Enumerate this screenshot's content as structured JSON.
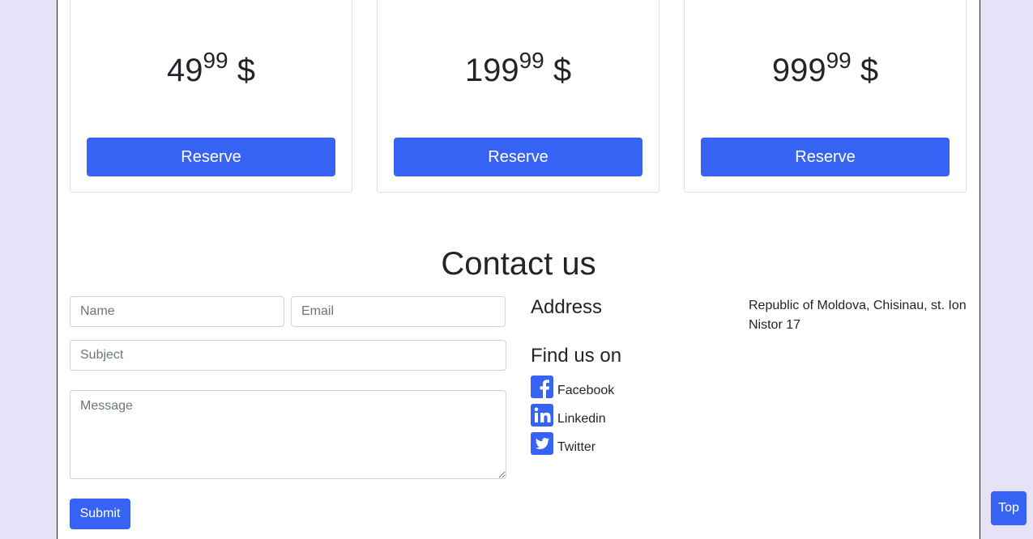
{
  "pricing": {
    "plans": [
      {
        "price_main": "49",
        "price_cents": "99",
        "currency": "$",
        "button_label": "Reserve"
      },
      {
        "price_main": "199",
        "price_cents": "99",
        "currency": "$",
        "button_label": "Reserve"
      },
      {
        "price_main": "999",
        "price_cents": "99",
        "currency": "$",
        "button_label": "Reserve"
      }
    ]
  },
  "contact": {
    "heading": "Contact us",
    "form": {
      "name_placeholder": "Name",
      "email_placeholder": "Email",
      "subject_placeholder": "Subject",
      "message_placeholder": "Message",
      "submit_label": "Submit"
    },
    "address_heading": "Address",
    "address_text": "Republic of Moldova, Chisinau, st. Ion Nistor 17",
    "find_heading": "Find us on",
    "social": [
      {
        "label": "Facebook",
        "icon": "facebook-square-icon"
      },
      {
        "label": "Linkedin",
        "icon": "linkedin-square-icon"
      },
      {
        "label": "Twitter",
        "icon": "twitter-square-icon"
      }
    ]
  },
  "top_button": {
    "label": "Top"
  },
  "colors": {
    "accent": "#3763f4",
    "background": "#e6e2f8",
    "text": "#212529"
  }
}
